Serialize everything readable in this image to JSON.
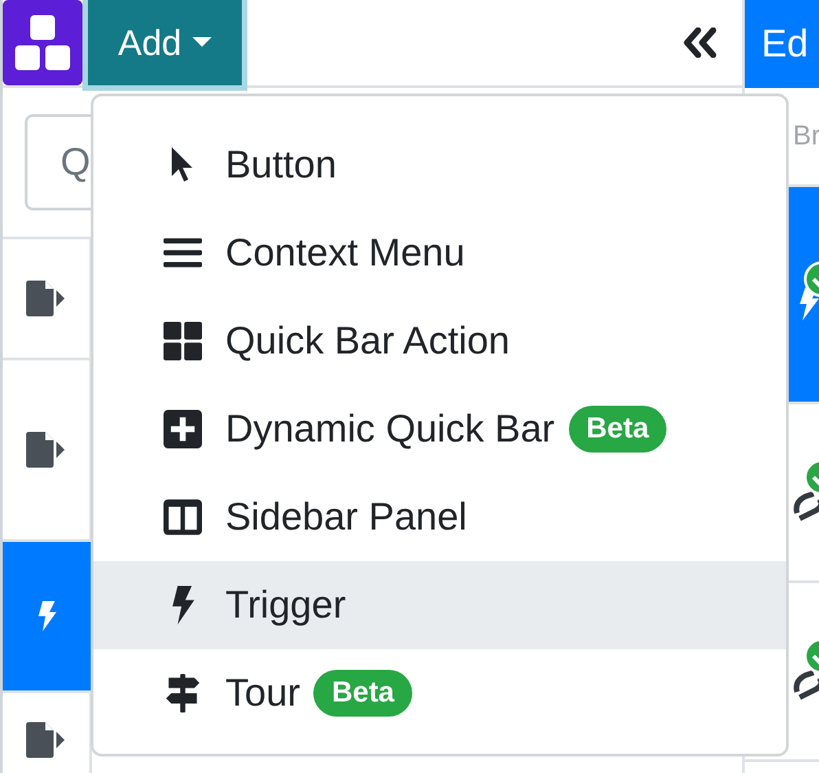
{
  "toolbar": {
    "add_button": {
      "label": "Add"
    },
    "edit_button": {
      "label": "Ed"
    }
  },
  "search": {
    "placeholder": "Q"
  },
  "bricks": [
    {
      "kind": "document",
      "selected": false
    },
    {
      "kind": "document",
      "selected": false
    },
    {
      "kind": "trigger",
      "selected": true
    },
    {
      "kind": "document",
      "selected": false
    }
  ],
  "right_panel": {
    "search": {
      "placeholder": "Br"
    },
    "rows": [
      {
        "kind": "trigger",
        "selected": true
      },
      {
        "kind": "link",
        "selected": false
      },
      {
        "kind": "link",
        "selected": false
      }
    ]
  },
  "add_menu": {
    "items": [
      {
        "kind": "pointer",
        "label": "Button",
        "hovered": false
      },
      {
        "kind": "bars",
        "label": "Context Menu",
        "hovered": false
      },
      {
        "kind": "grid",
        "label": "Quick Bar Action",
        "hovered": false
      },
      {
        "kind": "plus",
        "label": "Dynamic Quick Bar",
        "badge": "Beta",
        "hovered": false
      },
      {
        "kind": "columns",
        "label": "Sidebar Panel",
        "hovered": false
      },
      {
        "kind": "bolt",
        "label": "Trigger",
        "hovered": true
      },
      {
        "kind": "signs",
        "label": "Tour",
        "badge": "Beta",
        "hovered": false
      }
    ]
  }
}
